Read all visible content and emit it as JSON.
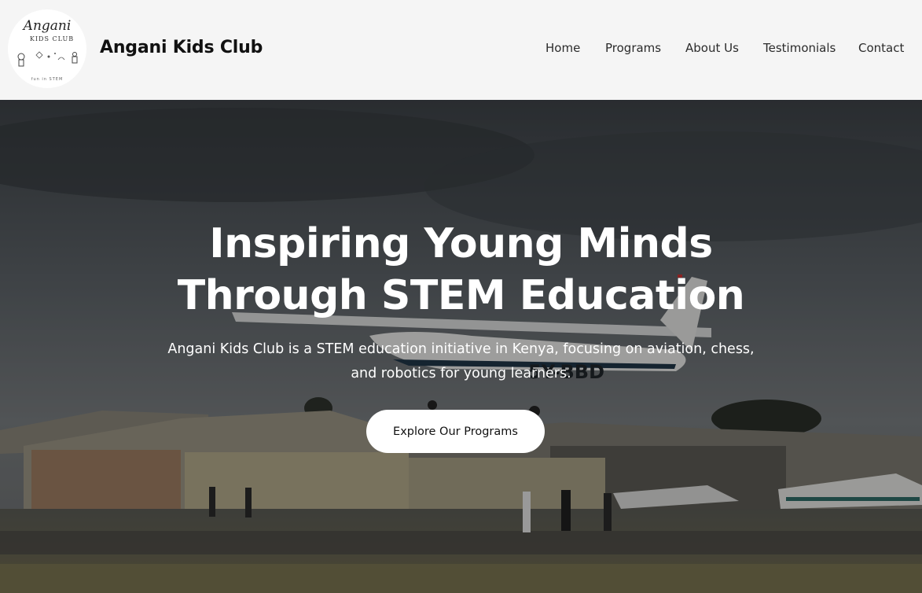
{
  "header": {
    "brand": "Angani Kids Club",
    "logo": {
      "line1": "Angani",
      "line2": "KIDS CLUB",
      "line3": "fun in STEM"
    },
    "nav": [
      {
        "label": "Home"
      },
      {
        "label": "Programs"
      },
      {
        "label": "About Us"
      },
      {
        "label": "Testimonials"
      },
      {
        "label": "Contact"
      }
    ]
  },
  "hero": {
    "title_line1": "Inspiring Young Minds",
    "title_line2": "Through STEM Education",
    "subtitle": "Angani Kids Club is a STEM education initiative in Kenya, focusing on aviation, chess, and robotics for young learners.",
    "cta_label": "Explore Our Programs",
    "plane_registration": "5Y-BBD"
  },
  "colors": {
    "header_bg": "#f5f5f5",
    "hero_text": "#ffffff",
    "cta_bg": "#ffffff"
  }
}
